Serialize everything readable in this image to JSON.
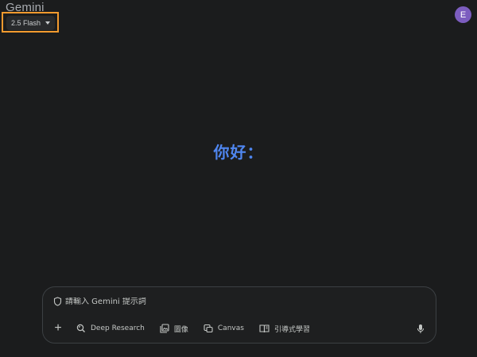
{
  "header": {
    "app_title": "Gemini",
    "model_label": "2.5 Flash",
    "avatar_initial": "E"
  },
  "main": {
    "greeting": "你好："
  },
  "composer": {
    "placeholder": "請輸入 Gemini 提示詞",
    "tools": [
      {
        "label": "Deep Research",
        "icon": "deep-research-icon"
      },
      {
        "label": "圖像",
        "icon": "image-icon"
      },
      {
        "label": "Canvas",
        "icon": "canvas-icon"
      },
      {
        "label": "引導式學習",
        "icon": "guided-learning-icon"
      }
    ],
    "add_icon": "plus-icon",
    "mic_icon": "mic-icon"
  },
  "colors": {
    "background": "#1b1c1d",
    "greeting": "#4f86f0",
    "highlight": "#f29a2e",
    "avatar": "#7c5dbf"
  }
}
